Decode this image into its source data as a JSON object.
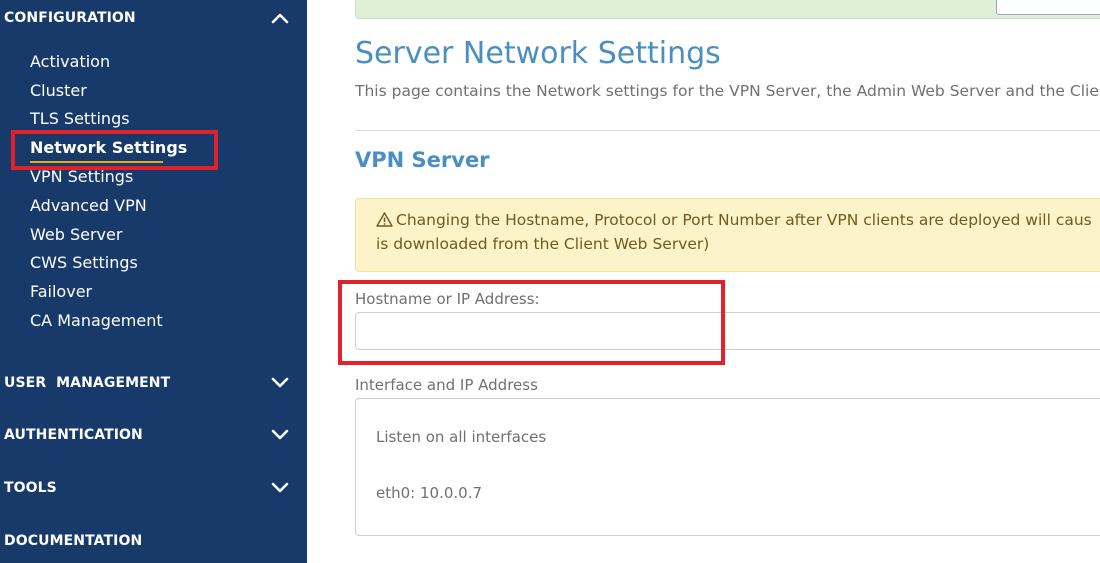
{
  "colors": {
    "sidebar_bg": "#173a6b",
    "accent": "#4a8fc2",
    "highlight": "#e0232b",
    "active_underline": "#e8a917",
    "warning_bg": "#fdf3c8",
    "success_bg": "#dff0d8"
  },
  "sidebar": {
    "configuration": {
      "title": "CONFIGURATION",
      "expanded": true,
      "icon": "chevron-up-icon",
      "items": [
        {
          "label": "Activation"
        },
        {
          "label": "Cluster"
        },
        {
          "label": "TLS Settings"
        },
        {
          "label": "Network Settings",
          "active": true
        },
        {
          "label": "VPN Settings"
        },
        {
          "label": "Advanced VPN"
        },
        {
          "label": "Web Server"
        },
        {
          "label": "CWS Settings"
        },
        {
          "label": "Failover"
        },
        {
          "label": "CA Management"
        }
      ]
    },
    "user_management": {
      "title": "USER  MANAGEMENT",
      "icon": "chevron-down-icon"
    },
    "authentication": {
      "title": "AUTHENTICATION",
      "icon": "chevron-down-icon"
    },
    "tools": {
      "title": "TOOLS",
      "icon": "chevron-down-icon"
    },
    "documentation": {
      "title": "DOCUMENTATION"
    }
  },
  "main": {
    "title": "Server Network Settings",
    "description": "This page contains the Network settings for the VPN Server, the Admin Web Server and the Clie",
    "vpn_section": {
      "title": "VPN Server",
      "warning_icon": "warning-icon",
      "warning_line1": "Changing the Hostname, Protocol or Port Number after VPN clients are deployed will caus",
      "warning_line2": "is downloaded from the Client Web Server)",
      "hostname_label": "Hostname or IP Address:",
      "hostname_value": "",
      "interface_label": "Interface and IP Address",
      "interface_options": [
        "Listen on all interfaces",
        "eth0: 10.0.0.7"
      ]
    }
  }
}
